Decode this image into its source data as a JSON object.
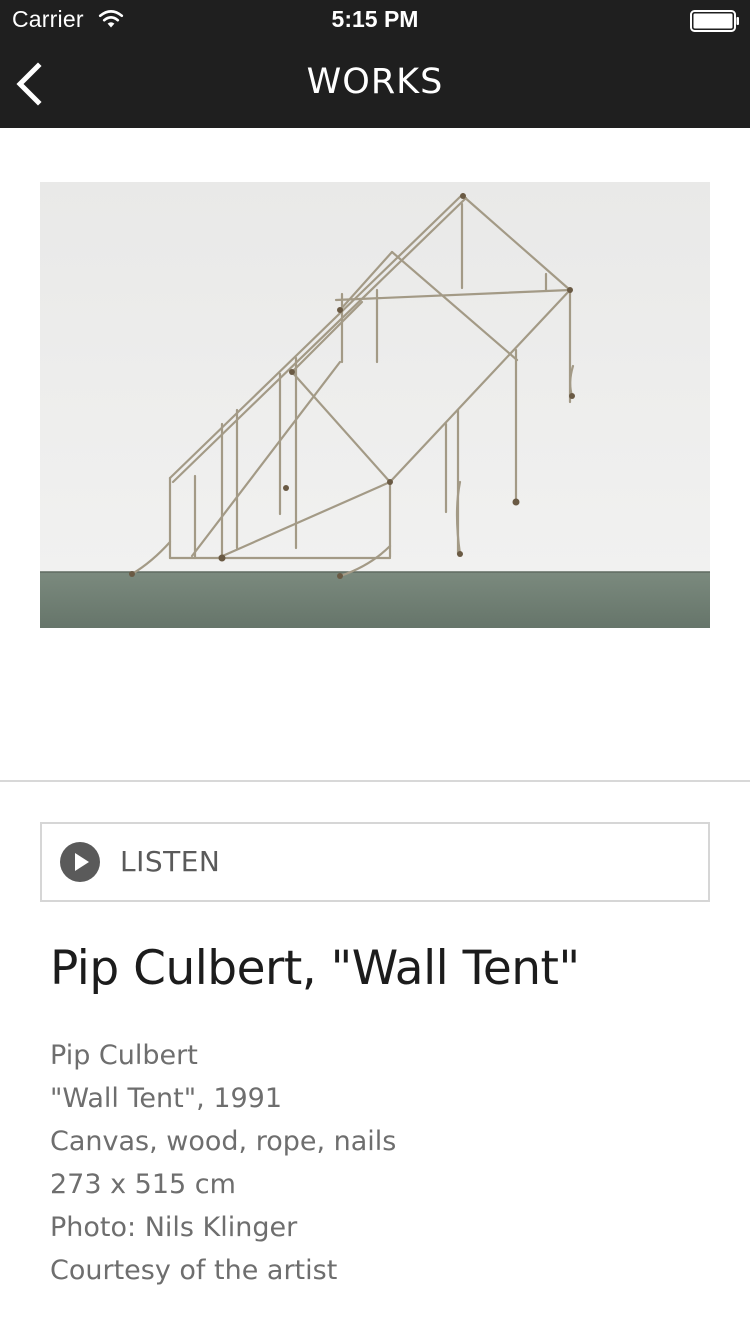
{
  "status_bar": {
    "carrier": "Carrier",
    "time": "5:15 PM",
    "wifi_icon": "wifi-icon",
    "battery_icon": "battery-full-icon"
  },
  "nav": {
    "title": "WORKS",
    "back_icon": "chevron-left-icon"
  },
  "artwork": {
    "image_subject": "rope and canvas tent-frame sculpture mounted on a white gallery wall above a grey floor"
  },
  "listen": {
    "label": "LISTEN",
    "icon": "play-icon"
  },
  "work": {
    "title": "Pip Culbert, \"Wall Tent\"",
    "details": [
      "Pip Culbert",
      "\"Wall Tent\", 1991",
      "Canvas, wood, rope, nails",
      "273 x 515 cm",
      "Photo: Nils Klinger",
      "Courtesy of the artist"
    ]
  },
  "colors": {
    "bar_background": "#1f1f1f",
    "bar_text": "#ffffff",
    "title_text": "#1c1c1c",
    "detail_text": "#6e6e6e",
    "listen_border": "#d6d6d6",
    "play_icon": "#5a5a5a"
  }
}
